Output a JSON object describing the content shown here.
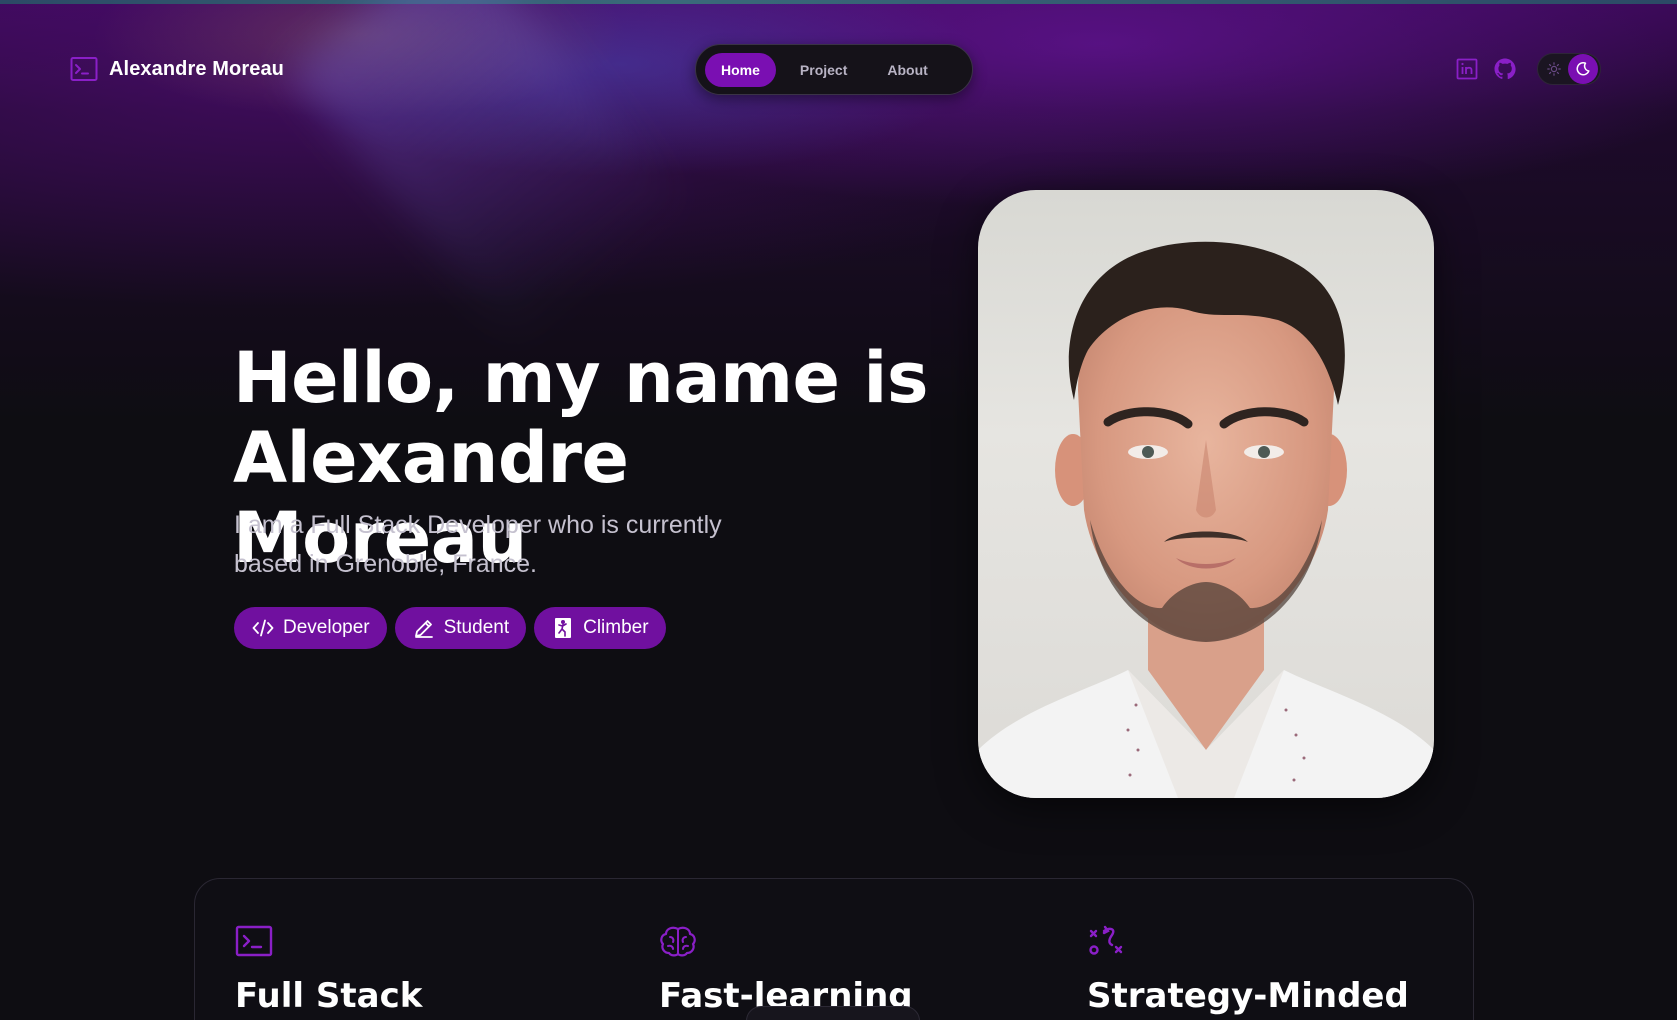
{
  "header": {
    "brand_name": "Alexandre Moreau",
    "nav": [
      {
        "label": "Home",
        "active": true
      },
      {
        "label": "Project",
        "active": false
      },
      {
        "label": "About",
        "active": false
      }
    ],
    "social": [
      "linkedin-icon",
      "github-icon"
    ],
    "theme": "dark"
  },
  "hero": {
    "title_line1": "Hello, my name is",
    "title_line2": "Alexandre Moreau",
    "subtitle_line1": "I am a Full Stack Developer who is currently",
    "subtitle_line2": "based in Grenoble, France.",
    "tags": [
      {
        "label": "Developer",
        "icon": "code-icon"
      },
      {
        "label": "Student",
        "icon": "pencil-icon"
      },
      {
        "label": "Climber",
        "icon": "climber-icon"
      }
    ]
  },
  "features": [
    {
      "title": "Full Stack",
      "icon": "terminal-icon"
    },
    {
      "title": "Fast-learning",
      "icon": "brain-icon"
    },
    {
      "title": "Strategy-Minded",
      "icon": "strategy-icon"
    }
  ],
  "colors": {
    "accent": "#7a0fb2",
    "tag_bg": "#70109f",
    "background": "#0e0d12",
    "icon_purple": "#8a1fc7"
  }
}
